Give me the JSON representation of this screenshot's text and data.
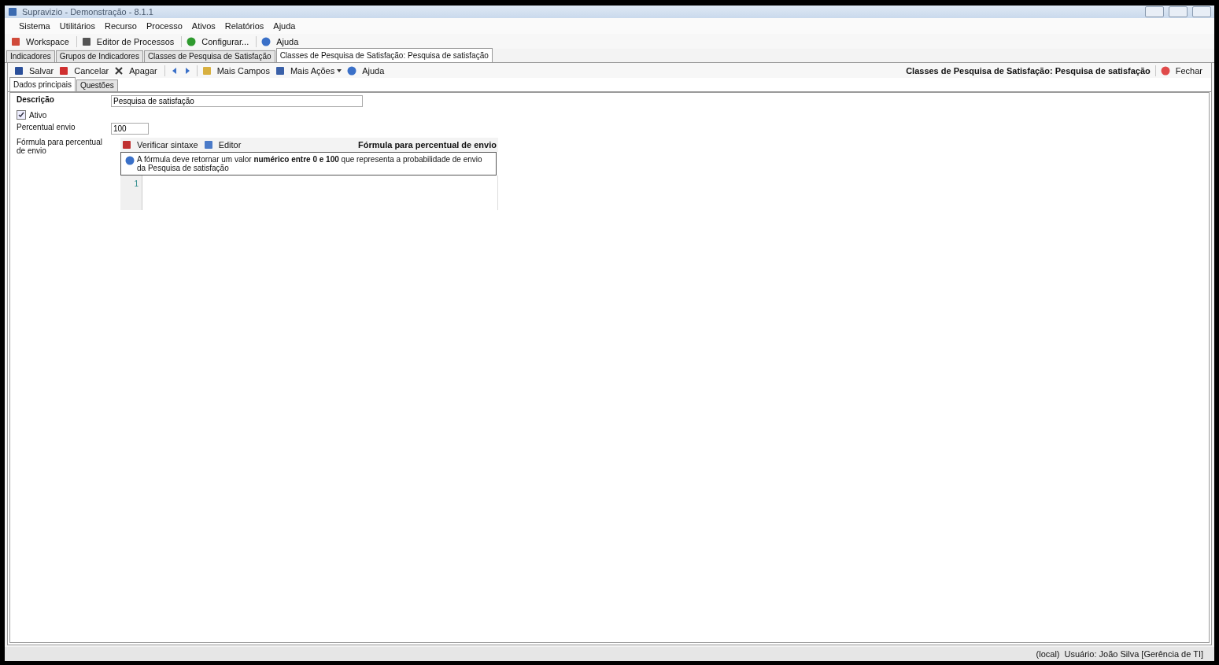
{
  "window": {
    "title": "Supravizio - Demonstração - 8.1.1"
  },
  "menu": [
    "Sistema",
    "Utilitários",
    "Recurso",
    "Processo",
    "Ativos",
    "Relatórios",
    "Ajuda"
  ],
  "toolbar": [
    "Workspace",
    "Editor de Processos",
    "Configurar...",
    "Ajuda"
  ],
  "doc_tabs": [
    {
      "label": "Indicadores",
      "selected": false
    },
    {
      "label": "Grupos de Indicadores",
      "selected": false
    },
    {
      "label": "Classes de Pesquisa de Satisfação",
      "selected": false
    },
    {
      "label": "Classes de Pesquisa de Satisfação: Pesquisa de satisfação",
      "selected": true
    }
  ],
  "actions": {
    "buttons": [
      "Salvar",
      "Cancelar",
      "Apagar",
      "Mais Campos",
      "Mais Ações",
      "Ajuda"
    ],
    "heading": "Classes de Pesquisa de Satisfação: Pesquisa de satisfação",
    "close": "Fechar"
  },
  "sub_tabs": [
    {
      "label": "Dados principais",
      "selected": true
    },
    {
      "label": "Questões",
      "selected": false
    }
  ],
  "form": {
    "description": {
      "label": "Descrição",
      "value": "Pesquisa de satisfação"
    },
    "active": {
      "label": "Ativo",
      "checked": true
    },
    "percent": {
      "label": "Percentual envio",
      "value": "100"
    },
    "formula": {
      "label": "Fórmula para percentual de envio",
      "tools": [
        "Verificar sintaxe",
        "Editor"
      ],
      "title": "Fórmula para percentual de envio",
      "hint": "A fórmula deve retornar um valor **numérico entre 0 e 100** que representa a probabilidade de envio da Pesquisa de satisfação",
      "line_numbers": [
        "1"
      ]
    }
  },
  "status_bar": [
    "(local)",
    "Usuário: João Silva [Gerência de TI]"
  ]
}
